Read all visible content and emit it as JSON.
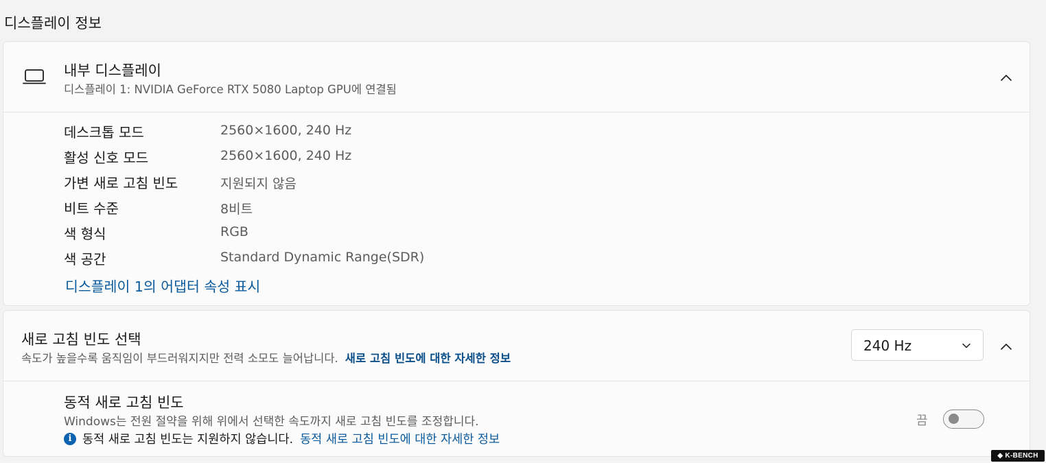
{
  "section_title": "디스플레이 정보",
  "internal_display": {
    "title": "내부 디스플레이",
    "subtitle": "디스플레이 1: NVIDIA GeForce RTX 5080 Laptop GPU에 연결됨",
    "icon": "laptop-icon",
    "expanded": true,
    "properties": [
      {
        "label": "데스크톱 모드",
        "value": "2560×1600, 240 Hz"
      },
      {
        "label": "활성 신호 모드",
        "value": "2560×1600, 240 Hz"
      },
      {
        "label": "가변 새로 고침 빈도",
        "value": "지원되지 않음"
      },
      {
        "label": "비트 수준",
        "value": "8비트"
      },
      {
        "label": "색 형식",
        "value": "RGB"
      },
      {
        "label": "색 공간",
        "value": "Standard Dynamic Range(SDR)"
      }
    ],
    "adapter_link": "디스플레이 1의 어댑터 속성 표시"
  },
  "refresh_rate": {
    "title": "새로 고침 빈도 선택",
    "description": "속도가 높을수록 움직임이 부드러워지지만 전력 소모도 늘어납니다.",
    "more_info_link": "새로 고침 빈도에 대한 자세한 정보",
    "selected_value": "240 Hz",
    "expanded": true,
    "dynamic": {
      "title": "동적 새로 고침 빈도",
      "description": "Windows는 전원 절약을 위해 위에서 선택한 속도까지 새로 고침 빈도를 조정합니다.",
      "info_text": "동적 새로 고침 빈도는 지원하지 않습니다.",
      "info_link": "동적 새로 고침 빈도에 대한 자세한 정보",
      "toggle_label": "끔",
      "toggle_on": false
    }
  },
  "watermark": "K-BENCH",
  "colors": {
    "link": "#0a5a9c",
    "info_icon": "#0a62b0",
    "background": "#f3f3f3",
    "card": "#fbfbfb"
  }
}
